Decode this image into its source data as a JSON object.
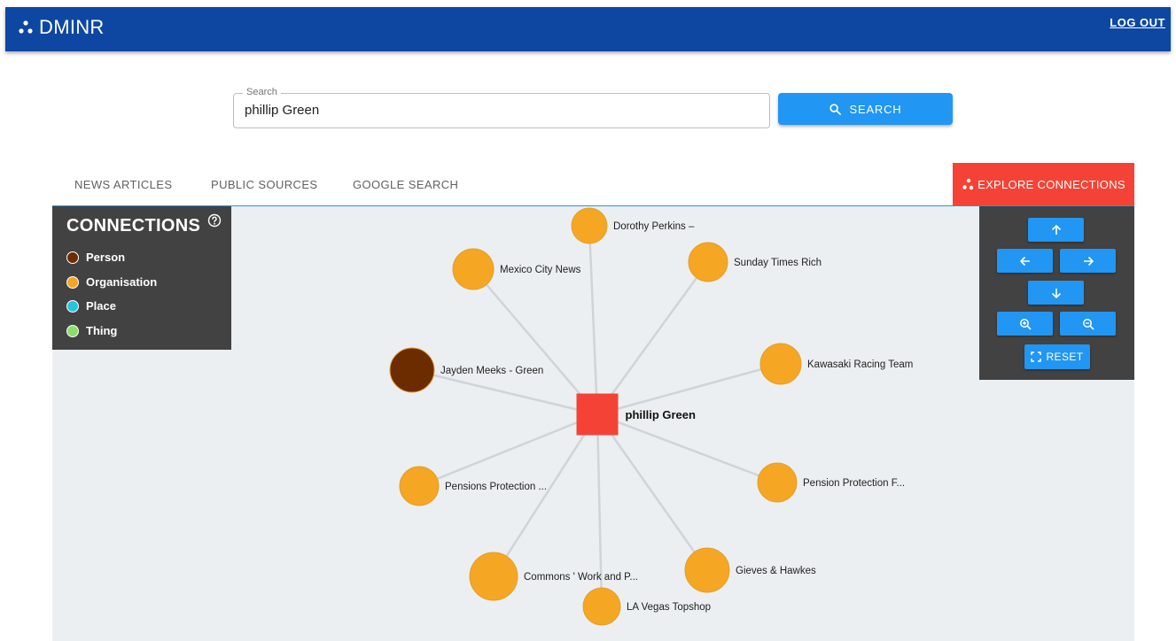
{
  "app": {
    "title": "DMINR",
    "logout_label": "LOG OUT"
  },
  "search": {
    "legend": "Search",
    "value": "phillip Green",
    "button_label": "SEARCH"
  },
  "tabs": {
    "news": "NEWS ARTICLES",
    "public": "PUBLIC SOURCES",
    "google": "GOOGLE SEARCH",
    "explore": "EXPLORE CONNECTIONS"
  },
  "legend": {
    "title": "CONNECTIONS",
    "items": [
      {
        "label": "Person",
        "color": "#6d2c00"
      },
      {
        "label": "Organisation",
        "color": "#f5a623"
      },
      {
        "label": "Place",
        "color": "#26c6da"
      },
      {
        "label": "Thing",
        "color": "#8bde6a"
      }
    ]
  },
  "controls": {
    "reset_label": "RESET"
  },
  "graph": {
    "center": {
      "label": "phillip Green",
      "color": "#f44336"
    },
    "nodes": [
      {
        "label": "Dorothy Perkins –",
        "type": "Organisation"
      },
      {
        "label": "Mexico City News",
        "type": "Organisation"
      },
      {
        "label": "Sunday Times Rich",
        "type": "Organisation"
      },
      {
        "label": "Jayden Meeks - Green",
        "type": "Person"
      },
      {
        "label": "Kawasaki Racing Team",
        "type": "Organisation"
      },
      {
        "label": "Pensions Protection ...",
        "type": "Organisation"
      },
      {
        "label": "Pension Protection F...",
        "type": "Organisation"
      },
      {
        "label": "Commons ' Work and P...",
        "type": "Organisation"
      },
      {
        "label": "Gieves & Hawkes",
        "type": "Organisation"
      },
      {
        "label": "LA Vegas Topshop",
        "type": "Organisation"
      }
    ]
  }
}
